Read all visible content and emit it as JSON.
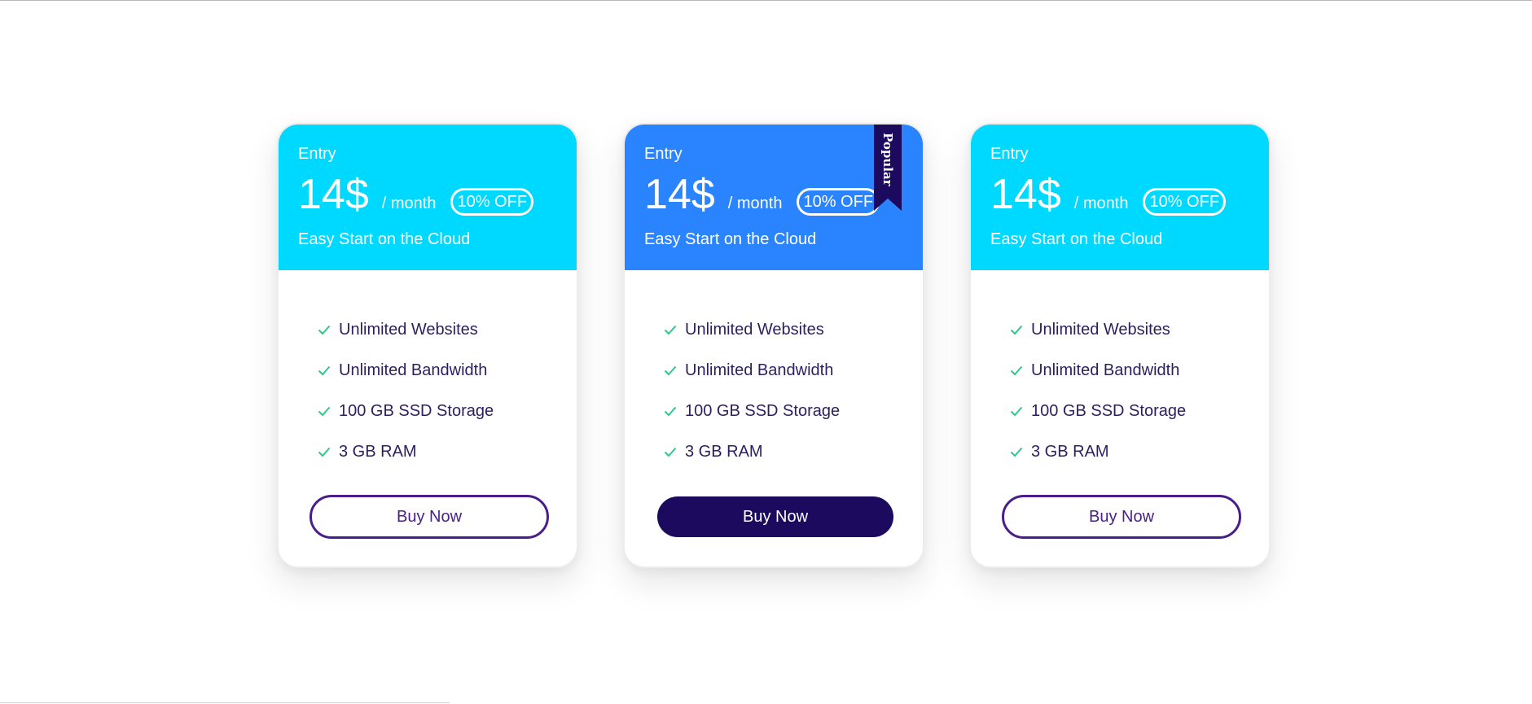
{
  "colors": {
    "header_cyan": "#00d9ff",
    "header_blue": "#2b84ff",
    "ribbon": "#1b0a5e",
    "check": "#2ec98a",
    "text_dark": "#2d1f5e",
    "button_outline": "#4a1d8c"
  },
  "plans": [
    {
      "tier": "Entry",
      "price": "14$",
      "period": "/ month",
      "discount": "10% OFF",
      "tagline": "Easy Start on the Cloud",
      "features": [
        "Unlimited Websites",
        "Unlimited Bandwidth",
        "100 GB SSD Storage",
        "3 GB RAM"
      ],
      "button_label": "Buy Now",
      "icon": "check-icon"
    },
    {
      "tier": "Entry",
      "price": "14$",
      "period": "/ month",
      "discount": "10% OFF",
      "tagline": "Easy Start on the Cloud",
      "ribbon": "Popular",
      "features": [
        "Unlimited Websites",
        "Unlimited Bandwidth",
        "100 GB SSD Storage",
        "3 GB RAM"
      ],
      "button_label": "Buy Now",
      "icon": "check-icon"
    },
    {
      "tier": "Entry",
      "price": "14$",
      "period": "/ month",
      "discount": "10% OFF",
      "tagline": "Easy Start on the Cloud",
      "features": [
        "Unlimited Websites",
        "Unlimited Bandwidth",
        "100 GB SSD Storage",
        "3 GB RAM"
      ],
      "button_label": "Buy Now",
      "icon": "check-icon"
    }
  ]
}
